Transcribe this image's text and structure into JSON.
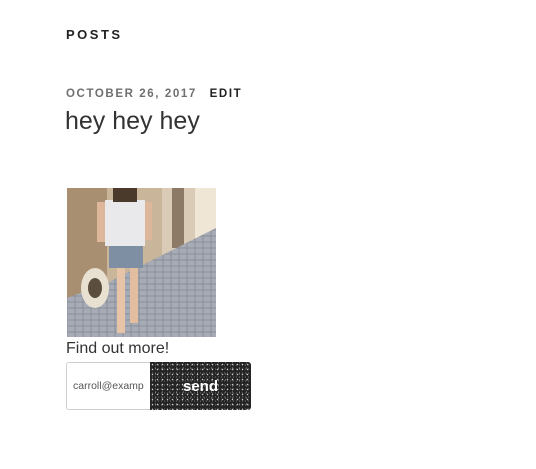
{
  "section": {
    "title": "POSTS"
  },
  "post": {
    "date": "OCTOBER 26, 2017",
    "edit_label": "EDIT",
    "title": "hey hey hey"
  },
  "cta": {
    "text": "Find out more!"
  },
  "signup": {
    "email_value": "carroll@example.com",
    "send_label": "send"
  }
}
